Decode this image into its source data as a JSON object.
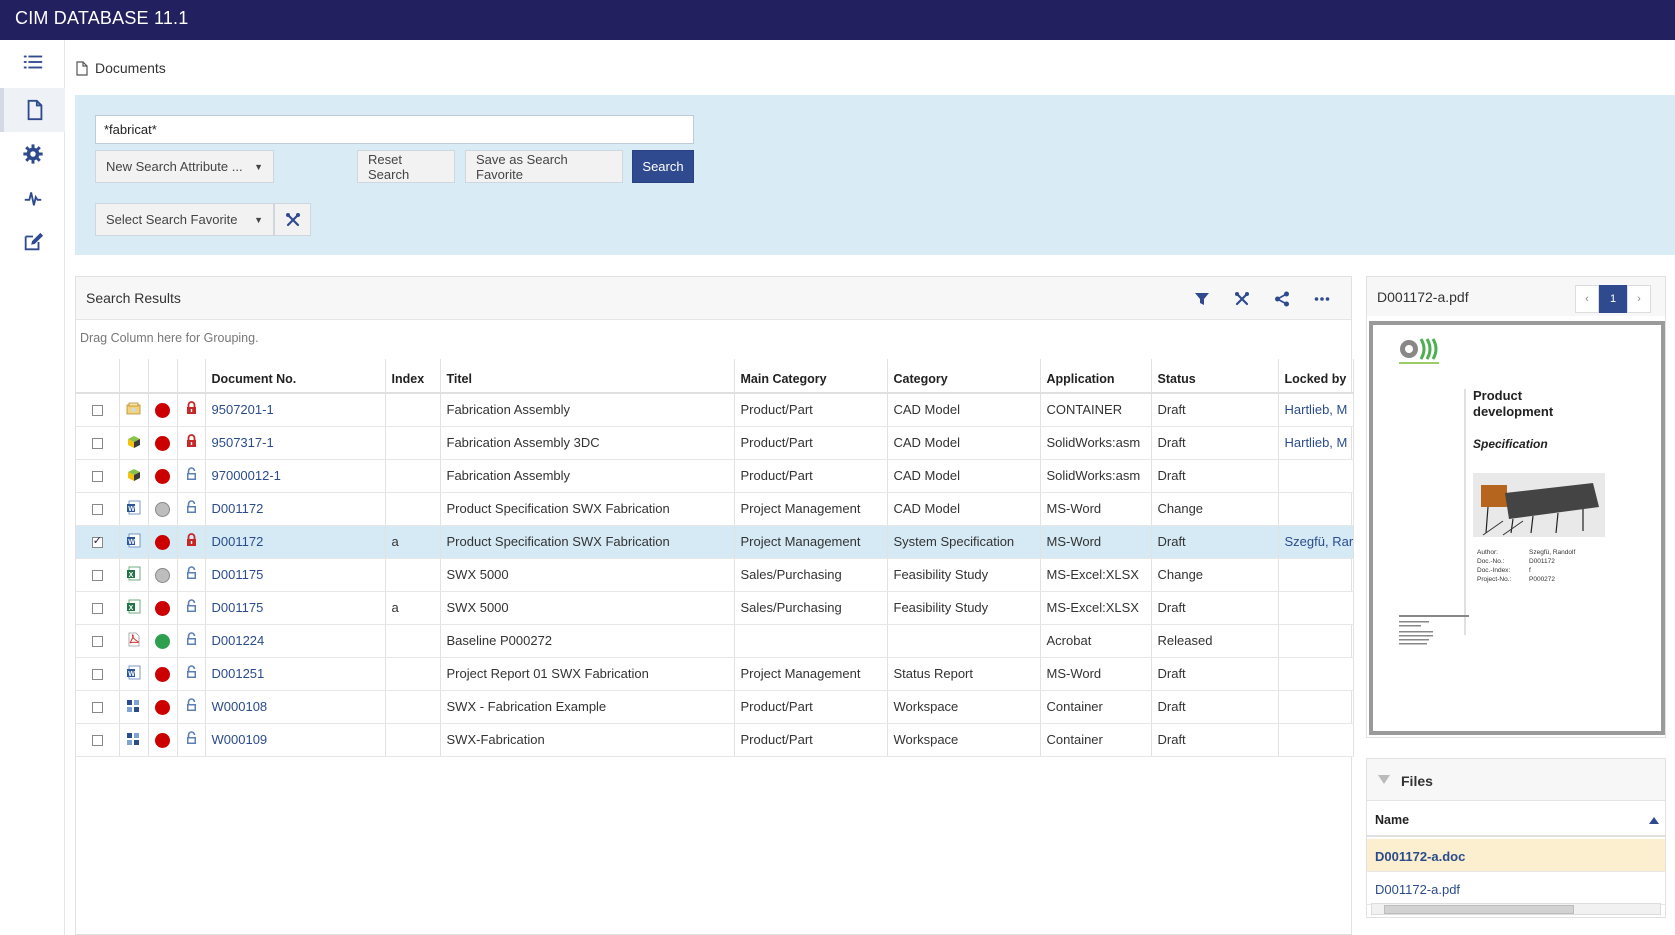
{
  "app": {
    "title": "CIM DATABASE 11.1"
  },
  "sidebar": {
    "items": [
      {
        "name": "menu",
        "icon": "list-icon"
      },
      {
        "name": "documents",
        "icon": "document-icon",
        "active": true
      },
      {
        "name": "settings",
        "icon": "gear-icon"
      },
      {
        "name": "activity",
        "icon": "pulse-icon"
      },
      {
        "name": "edit",
        "icon": "edit-icon"
      }
    ]
  },
  "breadcrumb": {
    "label": "Documents",
    "icon": "document-icon"
  },
  "search": {
    "query": "*fabricat*",
    "new_attribute_label": "New Search Attribute ...",
    "reset_label": "Reset Search",
    "save_favorite_label": "Save as Search Favorite",
    "search_label": "Search",
    "select_favorite_label": "Select Search Favorite",
    "accent_color": "#2f4a8e",
    "panel_color": "#d9ecf5"
  },
  "results": {
    "title": "Search Results",
    "group_hint": "Drag Column here for Grouping.",
    "tools": [
      "filter-icon",
      "tools-icon",
      "share-icon",
      "more-icon"
    ],
    "columns": [
      "",
      "",
      "",
      "",
      "Document No.",
      "Index",
      "Titel",
      "Main Category",
      "Category",
      "Application",
      "Status",
      "Locked by"
    ],
    "rows": [
      {
        "checked": false,
        "type_icon": "container-icon",
        "status_color": "#cc0000",
        "lock": "locked",
        "doc_no": "9507201-1",
        "index": "",
        "title": "Fabrication Assembly",
        "main_category": "Product/Part",
        "category": "CAD Model",
        "application": "CONTAINER",
        "status": "Draft",
        "locked_by": "Hartlieb, M"
      },
      {
        "checked": false,
        "type_icon": "assembly-3d-icon",
        "status_color": "#cc0000",
        "lock": "locked",
        "doc_no": "9507317-1",
        "index": "",
        "title": "Fabrication Assembly 3DC",
        "main_category": "Product/Part",
        "category": "CAD Model",
        "application": "SolidWorks:asm",
        "status": "Draft",
        "locked_by": "Hartlieb, M"
      },
      {
        "checked": false,
        "type_icon": "assembly-3d-icon",
        "status_color": "#cc0000",
        "lock": "unlocked",
        "doc_no": "97000012-1",
        "index": "",
        "title": "Fabrication Assembly",
        "main_category": "Product/Part",
        "category": "CAD Model",
        "application": "SolidWorks:asm",
        "status": "Draft",
        "locked_by": ""
      },
      {
        "checked": false,
        "type_icon": "word-icon",
        "status_color": "#bdbdbd",
        "lock": "unlocked",
        "doc_no": "D001172",
        "index": "",
        "title": "Product Specification SWX Fabrication",
        "main_category": "Project Management",
        "category": "CAD Model",
        "application": "MS-Word",
        "status": "Change",
        "locked_by": ""
      },
      {
        "checked": true,
        "selected": true,
        "type_icon": "word-icon",
        "status_color": "#cc0000",
        "lock": "locked",
        "doc_no": "D001172",
        "index": "a",
        "title": "Product Specification SWX Fabrication",
        "main_category": "Project Management",
        "category": "System Specification",
        "application": "MS-Word",
        "status": "Draft",
        "locked_by": "Szegfü, Rar"
      },
      {
        "checked": false,
        "type_icon": "excel-icon",
        "status_color": "#bdbdbd",
        "lock": "unlocked",
        "doc_no": "D001175",
        "index": "",
        "title": "SWX 5000",
        "main_category": "Sales/Purchasing",
        "category": "Feasibility Study",
        "application": "MS-Excel:XLSX",
        "status": "Change",
        "locked_by": ""
      },
      {
        "checked": false,
        "type_icon": "excel-icon",
        "status_color": "#cc0000",
        "lock": "unlocked",
        "doc_no": "D001175",
        "index": "a",
        "title": "SWX 5000",
        "main_category": "Sales/Purchasing",
        "category": "Feasibility Study",
        "application": "MS-Excel:XLSX",
        "status": "Draft",
        "locked_by": ""
      },
      {
        "checked": false,
        "type_icon": "pdf-icon",
        "status_color": "#2e9e4f",
        "lock": "unlocked",
        "doc_no": "D001224",
        "index": "",
        "title": "Baseline P000272",
        "main_category": "",
        "category": "",
        "application": "Acrobat",
        "status": "Released",
        "locked_by": ""
      },
      {
        "checked": false,
        "type_icon": "word-icon",
        "status_color": "#cc0000",
        "lock": "unlocked",
        "doc_no": "D001251",
        "index": "",
        "title": "Project Report 01 SWX Fabrication",
        "main_category": "Project Management",
        "category": "Status Report",
        "application": "MS-Word",
        "status": "Draft",
        "locked_by": ""
      },
      {
        "checked": false,
        "type_icon": "workspace-icon",
        "status_color": "#cc0000",
        "lock": "unlocked",
        "doc_no": "W000108",
        "index": "",
        "title": "SWX - Fabrication Example",
        "main_category": "Product/Part",
        "category": "Workspace",
        "application": "Container",
        "status": "Draft",
        "locked_by": ""
      },
      {
        "checked": false,
        "type_icon": "workspace-icon",
        "status_color": "#cc0000",
        "lock": "unlocked",
        "doc_no": "W000109",
        "index": "",
        "title": "SWX-Fabrication",
        "main_category": "Product/Part",
        "category": "Workspace",
        "application": "Container",
        "status": "Draft",
        "locked_by": ""
      }
    ]
  },
  "preview": {
    "title": "D001172-a.pdf",
    "page": "1",
    "prev": "‹",
    "next": "›",
    "doc_heading1": "Product",
    "doc_heading2": "development",
    "doc_subheading": "Specification",
    "meta_labels": [
      "Author:",
      "Doc.-No.:",
      "Doc.-Index:",
      "Project-No.:"
    ],
    "meta_values": [
      "Szegfü, Randolf",
      "D001172",
      "f",
      "P000272"
    ]
  },
  "files": {
    "title": "Files",
    "column": "Name",
    "items": [
      {
        "name": "D001172-a.doc",
        "highlight": true
      },
      {
        "name": "D001172-a.pdf",
        "highlight": false
      }
    ]
  }
}
